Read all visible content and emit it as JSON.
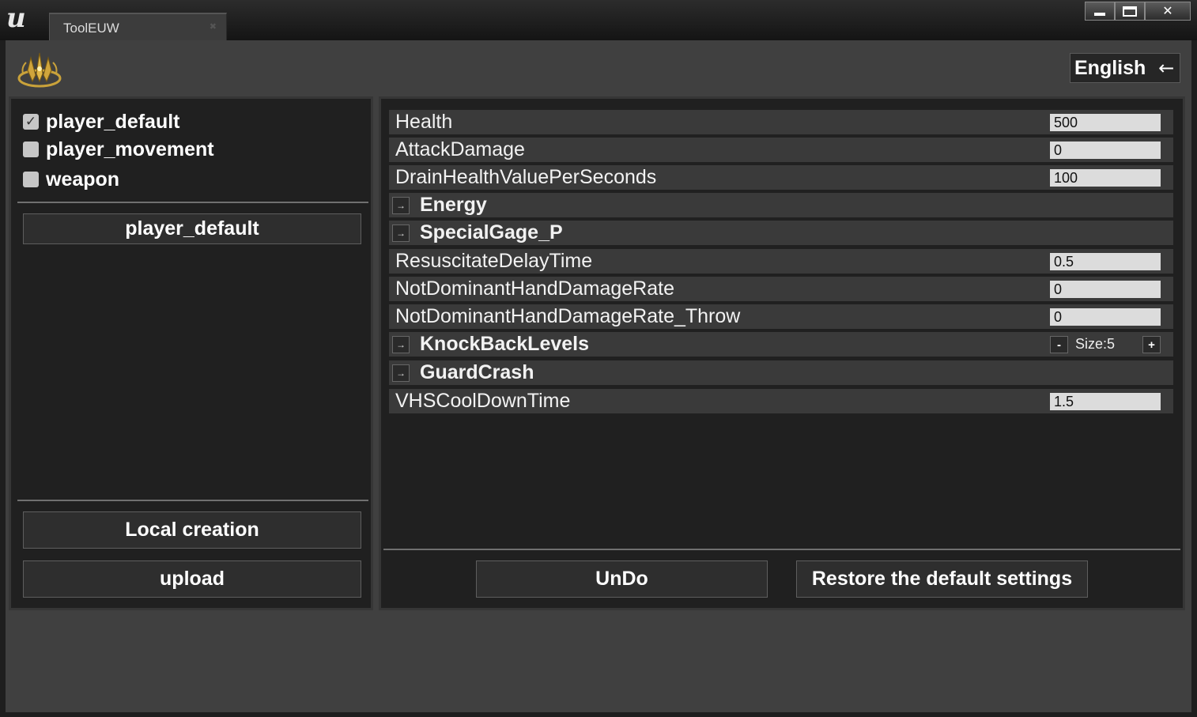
{
  "window": {
    "tab_title": "ToolEUW",
    "tab_close_glyph": "✖",
    "minimize_glyph": "",
    "maximize_glyph": "",
    "close_glyph": "✕",
    "engine_logo_glyph": "u"
  },
  "header": {
    "language_label": "English",
    "language_arrow": "←"
  },
  "left_panel": {
    "categories": [
      {
        "label": "player_default",
        "checked": true
      },
      {
        "label": "player_movement",
        "checked": false
      },
      {
        "label": "weapon",
        "checked": false
      }
    ],
    "checkmark_glyph": "✓",
    "selected_button_label": "player_default",
    "local_creation_label": "Local creation",
    "upload_label": "upload"
  },
  "properties": [
    {
      "name": "Health",
      "type": "value",
      "value": "500"
    },
    {
      "name": "AttackDamage",
      "type": "value",
      "value": "0"
    },
    {
      "name": "DrainHealthValuePerSeconds",
      "type": "value",
      "value": "100"
    },
    {
      "name": "Energy",
      "type": "group"
    },
    {
      "name": "SpecialGage_P",
      "type": "group"
    },
    {
      "name": "ResuscitateDelayTime",
      "type": "value",
      "value": "0.5"
    },
    {
      "name": "NotDominantHandDamageRate",
      "type": "value",
      "value": "0"
    },
    {
      "name": "NotDominantHandDamageRate_Throw",
      "type": "value",
      "value": "0"
    },
    {
      "name": "KnockBackLevels",
      "type": "array",
      "size_label": "Size:5",
      "minus": "-",
      "plus": "+"
    },
    {
      "name": "GuardCrash",
      "type": "group"
    },
    {
      "name": "VHSCoolDownTime",
      "type": "value",
      "value": "1.5"
    }
  ],
  "expander_glyph": "→",
  "footer": {
    "undo_label": "UnDo",
    "restore_label": "Restore the default settings"
  },
  "colors": {
    "panel_bg": "#202020",
    "window_bg": "#404040",
    "row_bg": "#3a3a3a",
    "input_bg": "#dcdcdc",
    "logo_gold": "#c9a23a"
  }
}
